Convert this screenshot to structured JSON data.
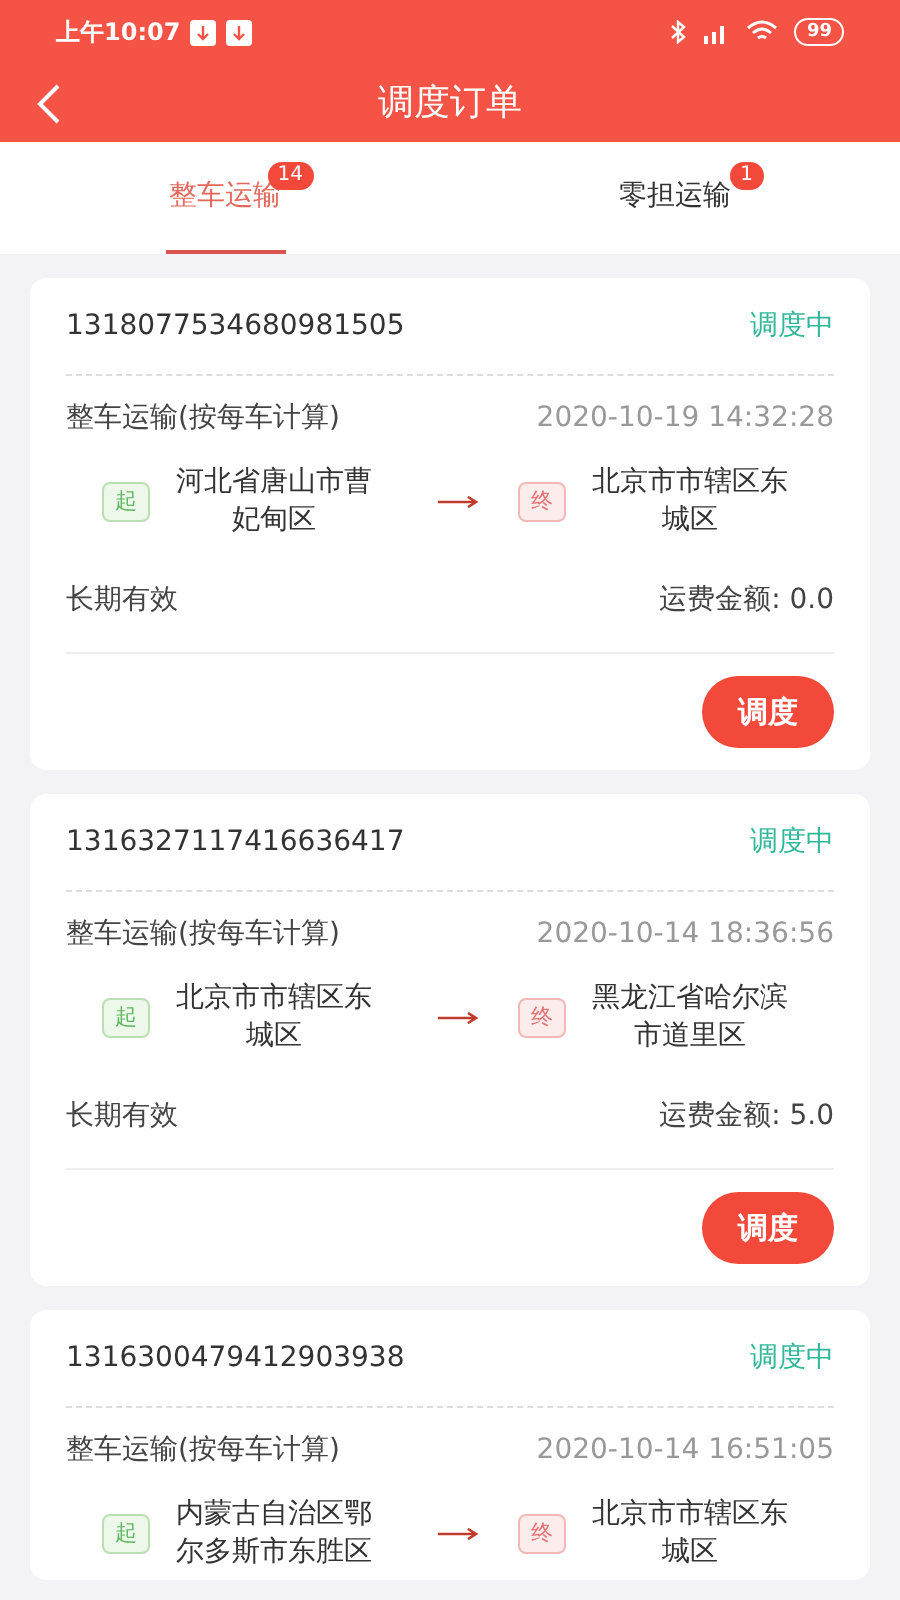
{
  "status_bar": {
    "time": "上午10:07",
    "battery": "99"
  },
  "header": {
    "title": "调度订单"
  },
  "tabs": [
    {
      "label": "整车运输",
      "badge": "14",
      "selected": true
    },
    {
      "label": "零担运输",
      "badge": "1",
      "selected": false
    }
  ],
  "orders": [
    {
      "id": "1318077534680981505",
      "status": "调度中",
      "type": "整车运输(按每车计算)",
      "time": "2020-10-19 14:32:28",
      "from_tag": "起",
      "from": "河北省唐山市曹妃甸区",
      "to_tag": "终",
      "to": "北京市市辖区东城区",
      "validity": "长期有效",
      "fee": "运费金额: 0.0",
      "action": "调度"
    },
    {
      "id": "1316327117416636417",
      "status": "调度中",
      "type": "整车运输(按每车计算)",
      "time": "2020-10-14 18:36:56",
      "from_tag": "起",
      "from": "北京市市辖区东城区",
      "to_tag": "终",
      "to": "黑龙江省哈尔滨市道里区",
      "validity": "长期有效",
      "fee": "运费金额: 5.0",
      "action": "调度"
    },
    {
      "id": "1316300479412903938",
      "status": "调度中",
      "type": "整车运输(按每车计算)",
      "time": "2020-10-14 16:51:05",
      "from_tag": "起",
      "from": "内蒙古自治区鄂尔多斯市东胜区",
      "to_tag": "终",
      "to": "北京市市辖区东城区"
    }
  ]
}
